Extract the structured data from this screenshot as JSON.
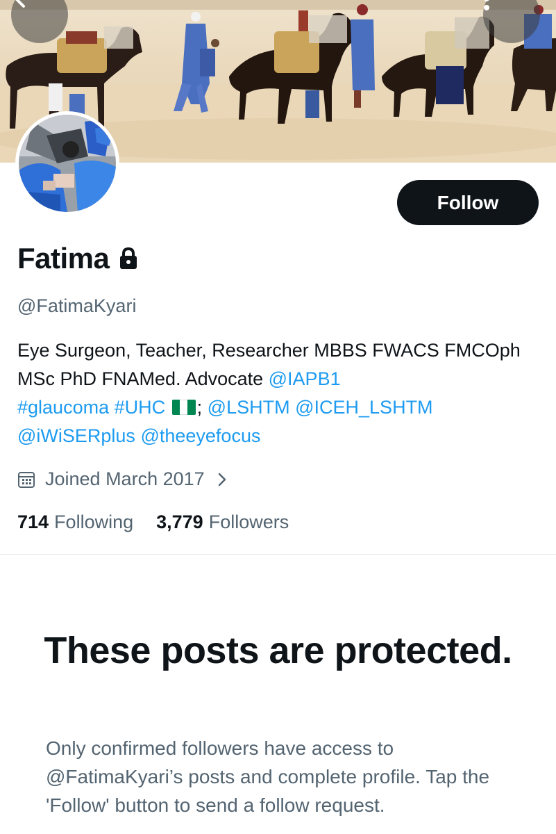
{
  "profile": {
    "display_name": "Fatima",
    "handle": "@FatimaKyari",
    "bio_text_1": "Eye Surgeon, Teacher, Researcher MBBS FWACS FMCOph MSc PhD FNAMed. Advocate ",
    "bio_link_iapb": "@IAPB1",
    "bio_hashtag_glaucoma": "#glaucoma",
    "bio_hashtag_uhc": "#UHC",
    "bio_separator": ";",
    "bio_link_lshtm": "@LSHTM",
    "bio_link_iceh": "@ICEH_LSHTM",
    "bio_link_iwiser": "@iWiSERplus",
    "bio_link_eyefocus": "@theeyefocus",
    "joined": "Joined March 2017",
    "following_count": "714",
    "following_label": "Following",
    "followers_count": "3,779",
    "followers_label": "Followers"
  },
  "actions": {
    "follow_label": "Follow"
  },
  "protected": {
    "title": "These posts are protected.",
    "body": "Only confirmed followers have access to @FatimaKyari’s posts and complete profile. Tap the 'Follow' button to send a follow request."
  },
  "icons": {
    "back": "arrow-left-icon",
    "more": "more-vertical-icon",
    "lock": "lock-icon",
    "calendar": "calendar-icon",
    "chevron": "chevron-right-icon",
    "flag": "nigeria-flag-emoji"
  },
  "colors": {
    "text": "#0f1419",
    "secondary": "#536471",
    "link": "#1d9bf0",
    "button_bg": "#0f1419",
    "button_text": "#ffffff",
    "flag_green": "#008751",
    "flag_white": "#ffffff"
  }
}
